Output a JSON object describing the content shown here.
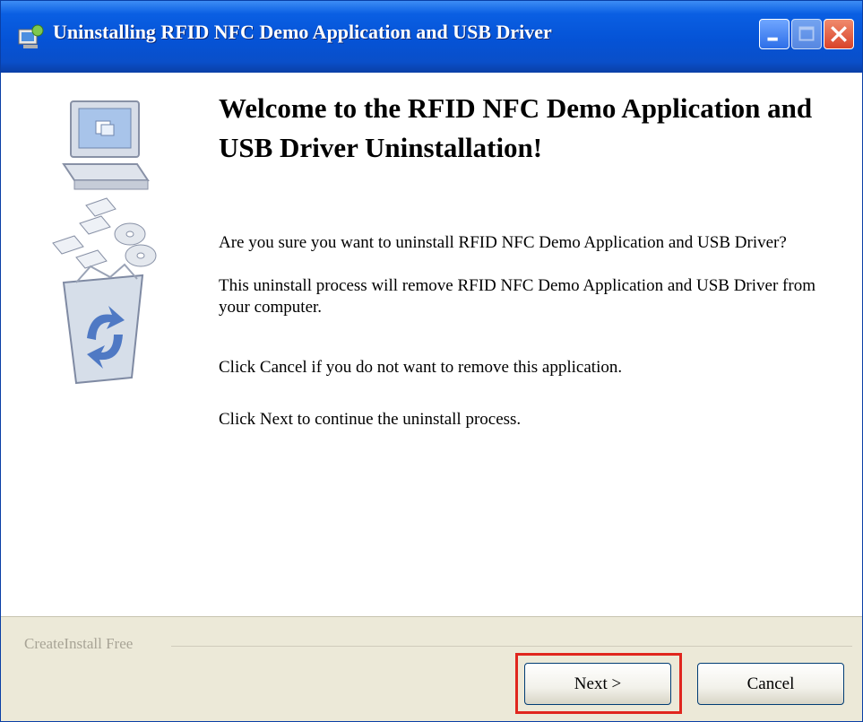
{
  "window": {
    "title": "Uninstalling RFID NFC Demo Application and USB Driver"
  },
  "icons": {
    "app": "installer-icon",
    "minimize": "minimize-icon",
    "maximize": "maximize-icon",
    "close": "close-icon",
    "computer": "computer-icon",
    "floppy": "floppy-disk-icon",
    "cd": "cd-icon",
    "recycle": "recycle-bin-icon"
  },
  "main": {
    "heading": "Welcome to the RFID NFC Demo Application and USB Driver Uninstallation!",
    "paragraph1": "Are you sure you want to uninstall RFID NFC Demo Application and USB Driver?",
    "paragraph2": "This uninstall process will remove RFID NFC Demo Application and USB Driver from your computer.",
    "paragraph3": "Click Cancel if you do not want to remove this application.",
    "paragraph4": "Click Next to continue the uninstall process."
  },
  "footer": {
    "brand": "CreateInstall Free",
    "next_label": "Next >",
    "cancel_label": "Cancel"
  },
  "colors": {
    "titlebar": "#0553d6",
    "footer_bg": "#ece9d8",
    "highlight": "#e0261e"
  }
}
